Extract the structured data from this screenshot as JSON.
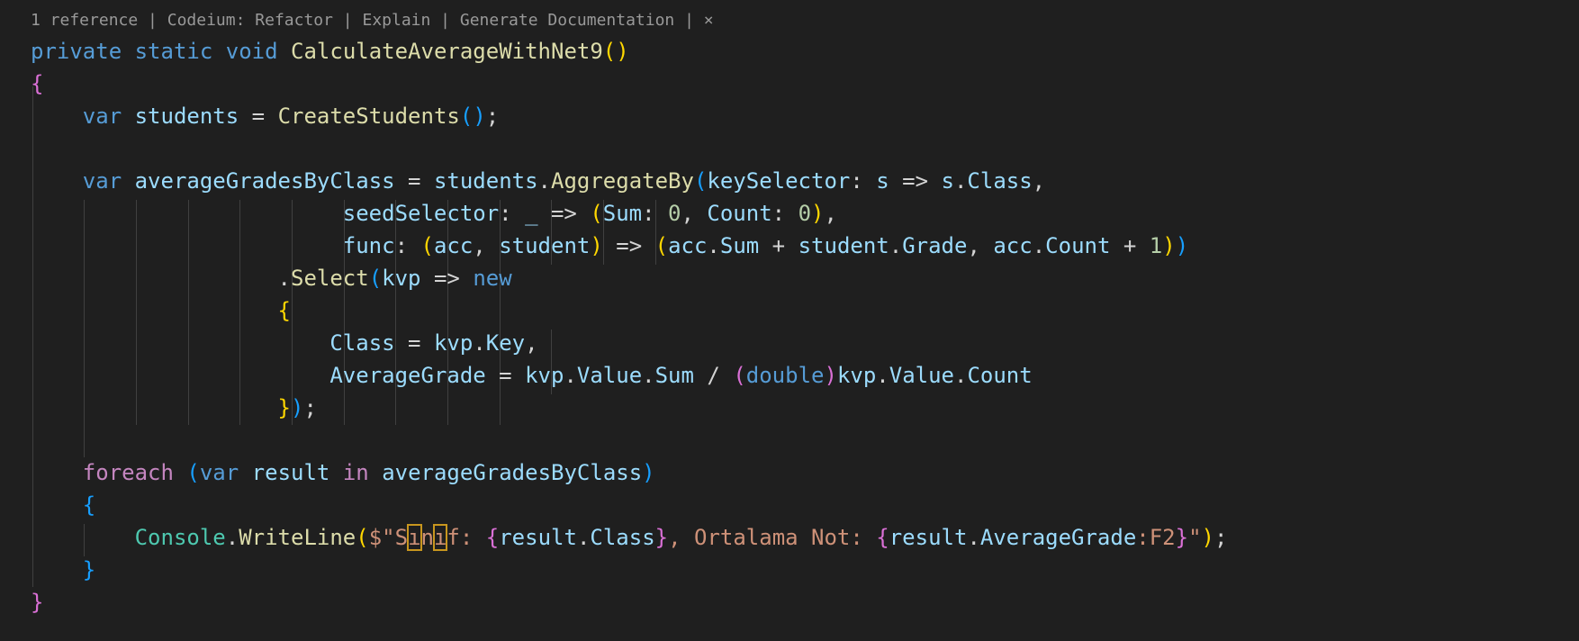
{
  "codelens": {
    "references": "1 reference",
    "refactor": "Codeium: Refactor",
    "explain": "Explain",
    "generate_docs": "Generate Documentation",
    "close": "×"
  },
  "code": {
    "l1": {
      "private": "private",
      "static": "static",
      "void": "void",
      "name": "CalculateAverageWithNet9",
      "open": "(",
      "close": ")"
    },
    "l2": {
      "brace": "{"
    },
    "l3": {
      "var": "var",
      "name": "students",
      "eq": " = ",
      "call": "CreateStudents",
      "open": "(",
      "close": ")",
      "semi": ";"
    },
    "l5": {
      "var": "var",
      "name": "averageGradesByClass",
      "eq": " = ",
      "obj": "students",
      "dot": ".",
      "call": "AggregateBy",
      "open": "(",
      "p1": "keySelector",
      "c1": ": ",
      "s": "s",
      "arrow": " => ",
      "s2": "s",
      "dot2": ".",
      "cls": "Class",
      "comma": ","
    },
    "l6": {
      "p": "seedSelector",
      "c": ": ",
      "u": "_",
      "arrow": " => ",
      "open": "(",
      "sum": "Sum",
      "c2": ": ",
      "zero": "0",
      "comma": ", ",
      "count": "Count",
      "c3": ": ",
      "zero2": "0",
      "close": ")",
      "comma2": ","
    },
    "l7": {
      "p": "func",
      "c": ": ",
      "open": "(",
      "acc": "acc",
      "comma": ", ",
      "student": "student",
      "close": ")",
      "arrow": " => ",
      "open2": "(",
      "acc2": "acc",
      "dot": ".",
      "sum": "Sum",
      "plus": " + ",
      "student2": "student",
      "dot2": ".",
      "grade": "Grade",
      "comma2": ", ",
      "acc3": "acc",
      "dot3": ".",
      "count": "Count",
      "plus2": " + ",
      "one": "1",
      "close2": ")",
      "close3": ")"
    },
    "l8": {
      "dot": ".",
      "call": "Select",
      "open": "(",
      "kvp": "kvp",
      "arrow": " => ",
      "new": "new"
    },
    "l9": {
      "brace": "{"
    },
    "l10": {
      "cls": "Class",
      "eq": " = ",
      "kvp": "kvp",
      "dot": ".",
      "key": "Key",
      "comma": ","
    },
    "l11": {
      "ag": "AverageGrade",
      "eq": " = ",
      "kvp": "kvp",
      "dot": ".",
      "value": "Value",
      "dot2": ".",
      "sum": "Sum",
      "div": " / ",
      "open": "(",
      "double": "double",
      "close": ")",
      "kvp2": "kvp",
      "dot3": ".",
      "value2": "Value",
      "dot4": ".",
      "count": "Count"
    },
    "l12": {
      "brace": "}",
      "close": ")",
      "semi": ";"
    },
    "l14": {
      "foreach": "foreach",
      "open": "(",
      "var": "var",
      "result": "result",
      "in": "in",
      "coll": "averageGradesByClass",
      "close": ")"
    },
    "l15": {
      "brace": "{"
    },
    "l16": {
      "console": "Console",
      "dot": ".",
      "call": "WriteLine",
      "open": "(",
      "dollar": "$\"",
      "s1": "S",
      "h1": "ı",
      "s2": "n",
      "h2": "ı",
      "s3": "f: ",
      "ob1": "{",
      "r1": "result",
      "d1": ".",
      "cls": "Class",
      "cb1": "}",
      "mid": ", Ortalama Not: ",
      "ob2": "{",
      "r2": "result",
      "d2": ".",
      "ag": "AverageGrade",
      "fmt": ":F2",
      "cb2": "}",
      "q": "\"",
      "close": ")",
      "semi": ";"
    },
    "l17": {
      "brace": "}"
    },
    "l18": {
      "brace": "}"
    }
  }
}
